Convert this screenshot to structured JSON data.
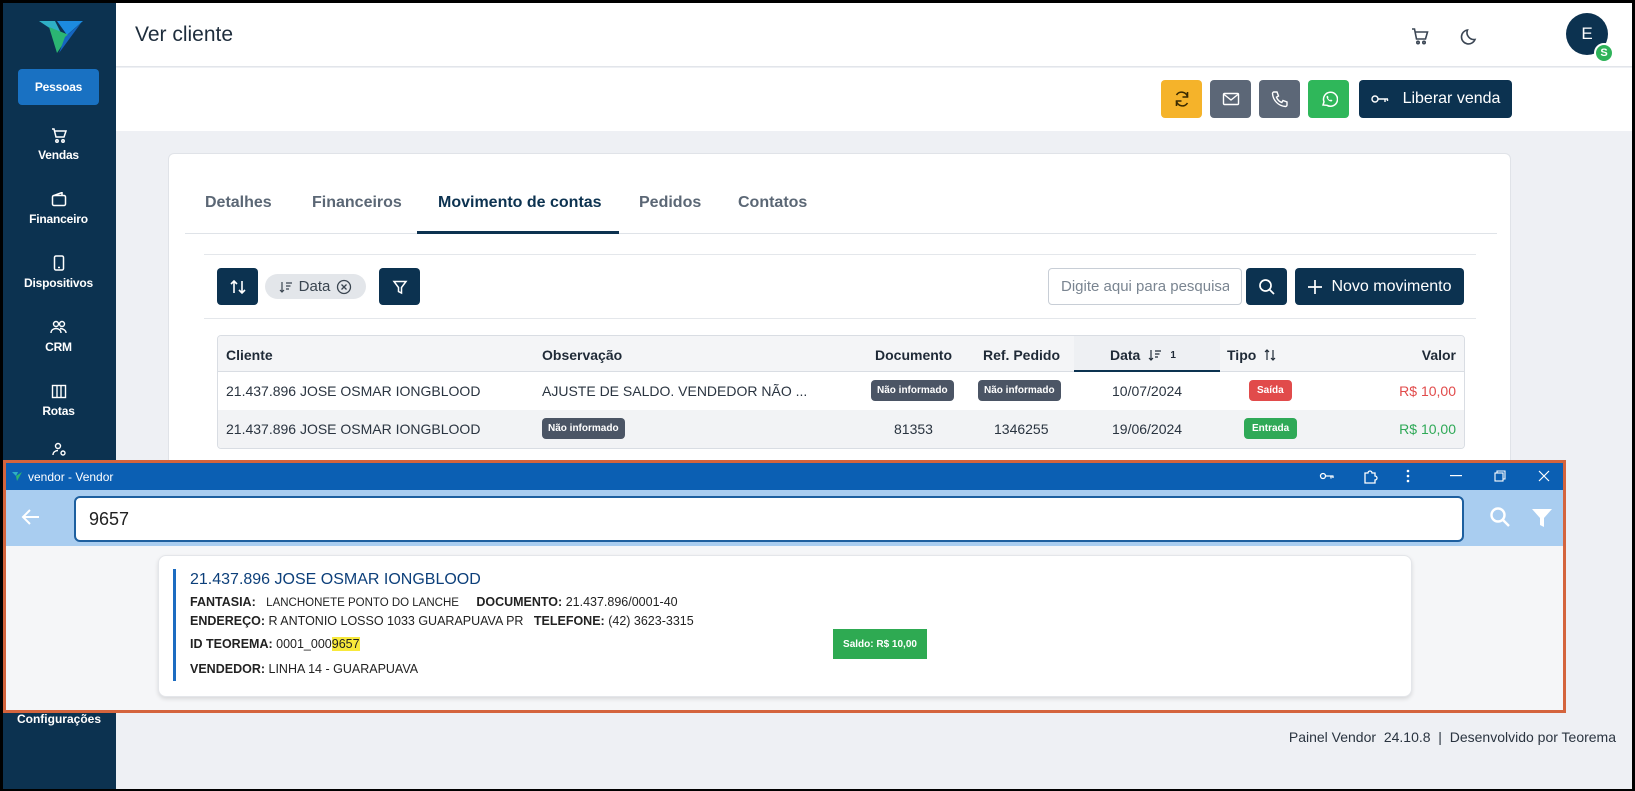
{
  "header": {
    "title": "Ver cliente",
    "avatar_letter": "E",
    "avatar_badge": "S"
  },
  "sidebar": {
    "items": [
      {
        "label": "Pessoas"
      },
      {
        "label": "Vendas"
      },
      {
        "label": "Financeiro"
      },
      {
        "label": "Dispositivos"
      },
      {
        "label": "CRM"
      },
      {
        "label": "Rotas"
      },
      {
        "label": "Configurações"
      }
    ]
  },
  "actions": {
    "liberar_label": "Liberar venda"
  },
  "tabs": [
    {
      "label": "Detalhes"
    },
    {
      "label": "Financeiros"
    },
    {
      "label": "Movimento de contas"
    },
    {
      "label": "Pedidos"
    },
    {
      "label": "Contatos"
    }
  ],
  "toolbar": {
    "chip_label": "Data",
    "search_placeholder": "Digite aqui para pesquisar",
    "novo_label": "Novo movimento"
  },
  "table": {
    "headers": {
      "cliente": "Cliente",
      "observacao": "Observação",
      "documento": "Documento",
      "ref_pedido": "Ref. Pedido",
      "data": "Data",
      "data_sort_index": "1",
      "tipo": "Tipo",
      "valor": "Valor"
    },
    "rows": [
      {
        "cliente": "21.437.896 JOSE OSMAR IONGBLOOD",
        "observacao": "AJUSTE DE SALDO. VENDEDOR NÃO ...",
        "documento": "Não informado",
        "ref_pedido": "Não informado",
        "data": "10/07/2024",
        "tipo": "Saída",
        "valor": "R$ 10,00"
      },
      {
        "cliente": "21.437.896 JOSE OSMAR IONGBLOOD",
        "observacao": "Não informado",
        "documento": "81353",
        "ref_pedido": "1346255",
        "data": "19/06/2024",
        "tipo": "Entrada",
        "valor": "R$ 10,00"
      }
    ]
  },
  "footer": {
    "text": "Painel Vendor  24.10.8  |  Desenvolvido por Teorema"
  },
  "overlay": {
    "window_title": "vendor - Vendor",
    "query": "9657",
    "result": {
      "name": "21.437.896 JOSE OSMAR IONGBLOOD",
      "fantasia_label": "FANTASIA:",
      "fantasia": "LANCHONETE PONTO DO LANCHE",
      "documento_label": "DOCUMENTO:",
      "documento": "21.437.896/0001-40",
      "endereco_label": "ENDEREÇO:",
      "endereco": "R ANTONIO LOSSO 1033 GUARAPUAVA PR",
      "telefone_label": "TELEFONE:",
      "telefone": "(42) 3623-3315",
      "id_label": "ID TEOREMA:",
      "id_prefix": "0001_000",
      "id_match": "9657",
      "vendedor_label": "VENDEDOR:",
      "vendedor": "LINHA 14 - GUARAPUAVA",
      "saldo": "Saldo: R$ 10,00"
    }
  },
  "colors": {
    "navy": "#0c3250",
    "refresh": "#f5b32a",
    "mail": "#5c6777",
    "phone": "#5c6777",
    "whatsapp": "#2fb75a",
    "saida": "#e14b4b",
    "entrada": "#2fa957",
    "valor_negative": "#e14b4b",
    "valor_positive": "#2fa957",
    "highlight": "#f8e93b"
  }
}
